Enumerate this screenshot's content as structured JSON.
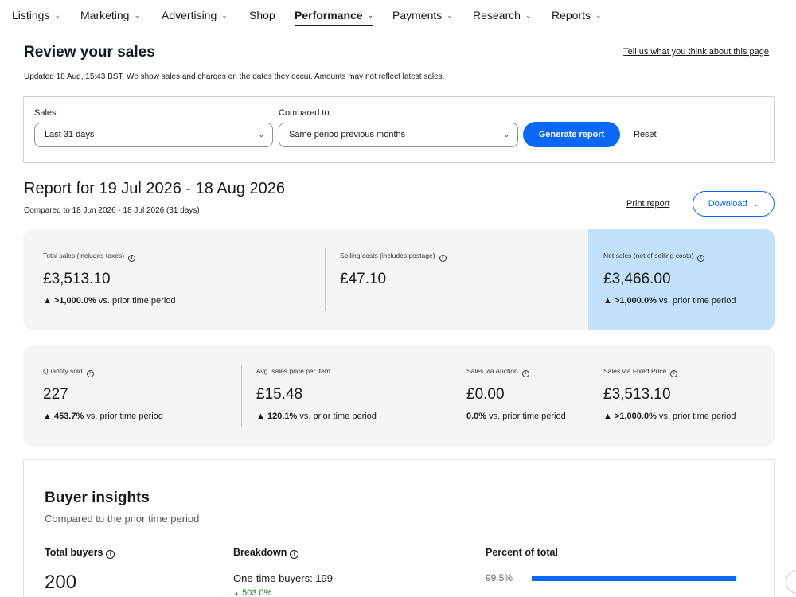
{
  "nav": {
    "items": [
      {
        "label": "Listings",
        "chevron": true
      },
      {
        "label": "Marketing",
        "chevron": true
      },
      {
        "label": "Advertising",
        "chevron": true
      },
      {
        "label": "Shop",
        "chevron": false
      },
      {
        "label": "Performance",
        "chevron": true,
        "active": true
      },
      {
        "label": "Payments",
        "chevron": true
      },
      {
        "label": "Research",
        "chevron": true
      },
      {
        "label": "Reports",
        "chevron": true
      }
    ]
  },
  "header": {
    "title": "Review your sales",
    "feedback_link": "Tell us what you think about this page",
    "updated_text": "Updated 18 Aug, 15:43 BST. We show sales and charges on the dates they occur. Amounts may not reflect latest sales."
  },
  "filters": {
    "sales_label": "Sales:",
    "sales_value": "Last 31 days",
    "compared_label": "Compared to:",
    "compared_value": "Same period previous months",
    "generate_label": "Generate report",
    "reset_label": "Reset"
  },
  "report": {
    "title": "Report for 19 Jul 2026 - 18 Aug 2026",
    "compared_text": "Compared to 18 Jun 2026 - 18 Jul 2026 (31 days)",
    "print_label": "Print report",
    "download_label": "Download"
  },
  "summary": {
    "total_sales": {
      "label": "Total sales (includes taxes)",
      "value": "£3,513.10",
      "change": ">1,000.0%",
      "suffix": "vs. prior time period"
    },
    "selling_costs": {
      "label": "Selling costs (includes postage)",
      "value": "£47.10"
    },
    "net_sales": {
      "label": "Net sales (net of selling costs)",
      "value": "£3,466.00",
      "change": ">1,000.0%",
      "suffix": "vs. prior time period"
    }
  },
  "details": {
    "quantity_sold": {
      "label": "Quantity sold",
      "value": "227",
      "change": "453.7%",
      "suffix": "vs. prior time period"
    },
    "avg_price": {
      "label": "Avg. sales price per item",
      "value": "£15.48",
      "change": "120.1%",
      "suffix": "vs. prior time period"
    },
    "auction": {
      "label": "Sales via Auction",
      "value": "£0.00",
      "change": "0.0%",
      "suffix": "vs. prior time period"
    },
    "fixed_price": {
      "label": "Sales via Fixed Price",
      "value": "£3,513.10",
      "change": ">1,000.0%",
      "suffix": "vs. prior time period"
    }
  },
  "insights": {
    "title": "Buyer insights",
    "subtitle": "Compared to the prior time period",
    "total_buyers_label": "Total buyers",
    "total_buyers_value": "200",
    "breakdown_label": "Breakdown",
    "one_time_buyers": "One-time buyers: 199",
    "one_time_change": "503.0%",
    "percent_label": "Percent of total",
    "percent_value": "99.5%",
    "percent_fraction": 0.995
  },
  "colors": {
    "accent": "#0968f6",
    "highlight": "#c2e2fb",
    "panel": "#f5f5f5",
    "positive": "#1a7f37"
  },
  "icons": [
    "chevron-down-icon",
    "info-icon",
    "up-triangle-icon"
  ]
}
